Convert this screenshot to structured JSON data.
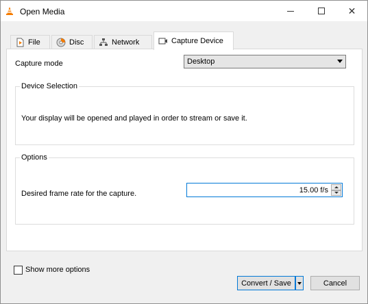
{
  "window": {
    "title": "Open Media",
    "controls": {
      "minimize": "—",
      "maximize": "☐",
      "close": "✕"
    }
  },
  "tabs": [
    {
      "label": "File",
      "icon": "file-icon",
      "active": false
    },
    {
      "label": "Disc",
      "icon": "disc-icon",
      "active": false
    },
    {
      "label": "Network",
      "icon": "network-icon",
      "active": false
    },
    {
      "label": "Capture Device",
      "icon": "capture-device-icon",
      "active": true
    }
  ],
  "capture": {
    "mode_label": "Capture mode",
    "mode_value": "Desktop"
  },
  "device_selection": {
    "title": "Device Selection",
    "description": "Your display will be opened and played in order to stream or save it."
  },
  "options": {
    "title": "Options",
    "frame_rate_label": "Desired frame rate for the capture.",
    "frame_rate_value": "15.00 f/s"
  },
  "footer": {
    "show_more_label": "Show more options",
    "show_more_checked": false,
    "convert_label": "Convert / Save",
    "cancel_label": "Cancel"
  },
  "colors": {
    "accent": "#0078d7",
    "vlc_orange": "#f57c00"
  }
}
